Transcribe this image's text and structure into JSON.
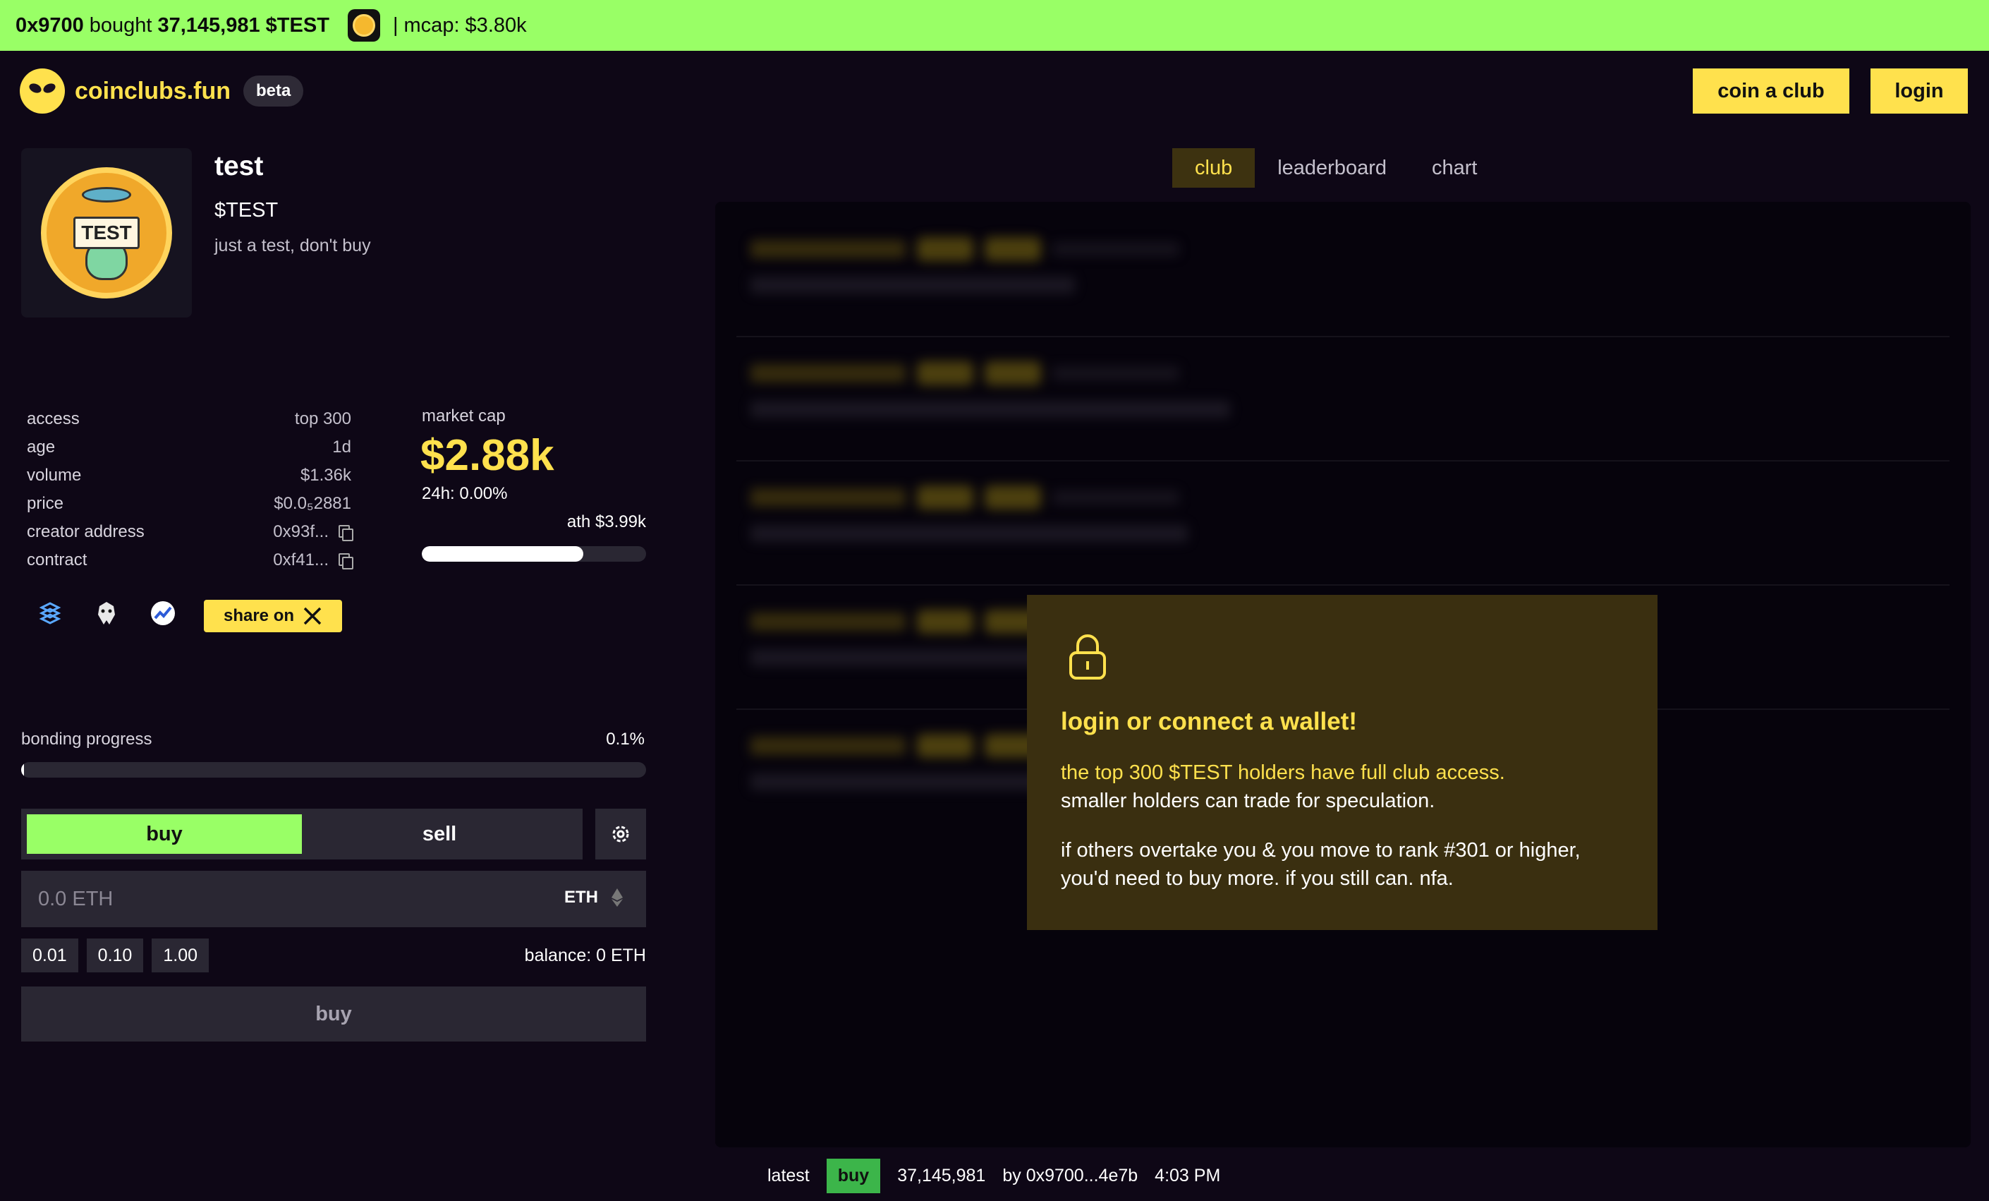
{
  "ticker": {
    "buyer": "0x9700",
    "action": "bought",
    "amount": "37,145,981 $TEST",
    "mcap": "| mcap: $3.80k",
    "coin_icon": "coin-avatar-icon"
  },
  "header": {
    "brand": "coinclubs.fun",
    "beta": "beta",
    "coin_a_club": "coin a club",
    "login": "login"
  },
  "coin": {
    "name": "test",
    "ticker": "$TEST",
    "description": "just a test, don't buy",
    "image_sign": "TEST"
  },
  "stats": [
    {
      "label": "access",
      "value": "top 300"
    },
    {
      "label": "age",
      "value": "1d"
    },
    {
      "label": "volume",
      "value": "$1.36k"
    },
    {
      "label": "price",
      "value": "$0.0₅2881"
    },
    {
      "label": "creator address",
      "value": "0x93f..."
    },
    {
      "label": "contract",
      "value": "0xf41..."
    }
  ],
  "market": {
    "label": "market cap",
    "value": "$2.88k",
    "change_24h": "24h: 0.00%",
    "ath": "ath $3.99k",
    "ath_progress": 0.72
  },
  "share": {
    "label": "share on"
  },
  "bonding": {
    "label": "bonding progress",
    "pct_text": "0.1%",
    "progress": 0.001
  },
  "trade": {
    "tab_buy": "buy",
    "tab_sell": "sell",
    "amount_placeholder": "0.0 ETH",
    "currency": "ETH",
    "quick": [
      "0.01",
      "0.10",
      "1.00"
    ],
    "balance": "balance: 0 ETH",
    "submit": "buy"
  },
  "view_tabs": [
    "club",
    "leaderboard",
    "chart"
  ],
  "active_tab": "club",
  "overlay": {
    "title": "login or connect a wallet!",
    "line1": "the top 300 $TEST holders have full club access.",
    "line2": "smaller holders can trade for speculation.",
    "line3": "if others overtake you & you move to rank #301 or higher,",
    "line4": "you'd need to buy more. if you still can. nfa."
  },
  "latest": {
    "label": "latest",
    "type": "buy",
    "amount": "37,145,981",
    "by": "by 0x9700...4e7b",
    "time": "4:03 PM"
  },
  "colors": {
    "accent": "#ffe14d",
    "buy_green": "#99ff66",
    "background": "#0e0716"
  }
}
